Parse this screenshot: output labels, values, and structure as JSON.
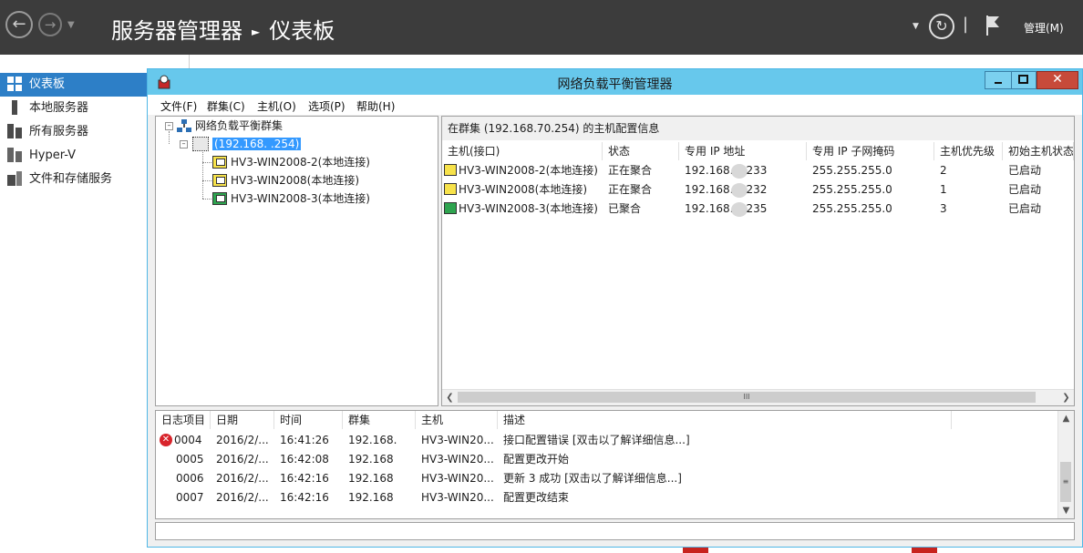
{
  "server_manager": {
    "title": "服务器管理器",
    "breadcrumb": "仪表板",
    "manage_menu": "管理(M)",
    "nav": [
      {
        "label": "仪表板",
        "icon": "dashboard-icon",
        "active": true
      },
      {
        "label": "本地服务器",
        "icon": "local-server-icon",
        "active": false
      },
      {
        "label": "所有服务器",
        "icon": "all-servers-icon",
        "active": false
      },
      {
        "label": "Hyper-V",
        "icon": "hyperv-icon",
        "active": false
      },
      {
        "label": "文件和存储服务",
        "icon": "file-storage-icon",
        "active": false
      }
    ]
  },
  "nlb": {
    "title": "网络负载平衡管理器",
    "menu": [
      "文件(F)",
      "群集(C)",
      "主机(O)",
      "选项(P)",
      "帮助(H)"
    ],
    "tree": {
      "root": "网络负载平衡群集",
      "cluster": "(192.168.      .254)",
      "hosts": [
        "HV3-WIN2008-2(本地连接)",
        "HV3-WIN2008(本地连接)",
        "HV3-WIN2008-3(本地连接)"
      ]
    },
    "list_caption": "在群集 (192.168.70.254) 的主机配置信息",
    "columns": [
      "主机(接口)",
      "状态",
      "专用 IP 地址",
      "专用 IP 子网掩码",
      "主机优先级",
      "初始主机状态"
    ],
    "rows": [
      {
        "host": "HV3-WIN2008-2(本地连接)",
        "status": "正在聚合",
        "ip_prefix": "192.168.",
        "ip_suffix": "233",
        "mask": "255.255.255.0",
        "priority": "2",
        "initial": "已启动",
        "color": "yellow"
      },
      {
        "host": "HV3-WIN2008(本地连接)",
        "status": "正在聚合",
        "ip_prefix": "192.168.",
        "ip_suffix": "232",
        "mask": "255.255.255.0",
        "priority": "1",
        "initial": "已启动",
        "color": "yellow"
      },
      {
        "host": "HV3-WIN2008-3(本地连接)",
        "status": "已聚合",
        "ip_prefix": "192.168.",
        "ip_suffix": "235",
        "mask": "255.255.255.0",
        "priority": "3",
        "initial": "已启动",
        "color": "green"
      }
    ],
    "log_columns": [
      "日志项目",
      "日期",
      "时间",
      "群集",
      "主机",
      "描述"
    ],
    "log_rows": [
      {
        "id": "0004",
        "date": "2016/2/...",
        "time": "16:41:26",
        "cluster": "192.168.",
        "host": "HV3-WIN20...",
        "desc": "接口配置错误 [双击以了解详细信息...]",
        "error": true
      },
      {
        "id": "0005",
        "date": "2016/2/...",
        "time": "16:42:08",
        "cluster": "192.168",
        "host": "HV3-WIN20...",
        "desc": "配置更改开始",
        "error": false
      },
      {
        "id": "0006",
        "date": "2016/2/...",
        "time": "16:42:16",
        "cluster": "192.168",
        "host": "HV3-WIN20...",
        "desc": "更新 3 成功 [双击以了解详细信息...]",
        "error": false
      },
      {
        "id": "0007",
        "date": "2016/2/...",
        "time": "16:42:16",
        "cluster": "192.168",
        "host": "HV3-WIN20...",
        "desc": "配置更改结束",
        "error": false
      }
    ],
    "scroll_thumb_glyph": "III",
    "colors": {
      "titlebar": "#67c8ec",
      "selection": "#3399ff",
      "nav_active": "#2d7fc7",
      "error": "#d8242b"
    }
  }
}
